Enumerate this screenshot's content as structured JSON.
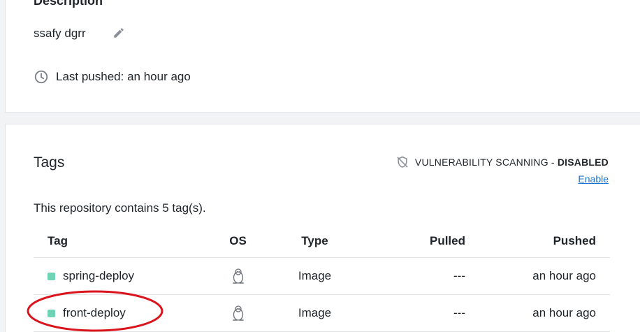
{
  "description": {
    "heading": "Description",
    "text": "ssafy dgrr",
    "edit_icon": "pencil-icon",
    "last_pushed": "Last pushed: an hour ago"
  },
  "tags": {
    "heading": "Tags",
    "scan_label": "VULNERABILITY SCANNING - ",
    "scan_status": "DISABLED",
    "enable_label": "Enable",
    "repo_count": "This repository contains 5 tag(s).",
    "columns": {
      "tag": "Tag",
      "os": "OS",
      "type": "Type",
      "pulled": "Pulled",
      "pushed": "Pushed"
    },
    "rows": [
      {
        "tag": "spring-deploy",
        "os": "linux-icon",
        "type": "Image",
        "pulled": "---",
        "pushed": "an hour ago"
      },
      {
        "tag": "front-deploy",
        "os": "linux-icon",
        "type": "Image",
        "pulled": "---",
        "pushed": "an hour ago"
      }
    ]
  },
  "colors": {
    "status_dot": "#6fd4b5",
    "link": "#1a73c9",
    "annotation": "#d9141c"
  }
}
